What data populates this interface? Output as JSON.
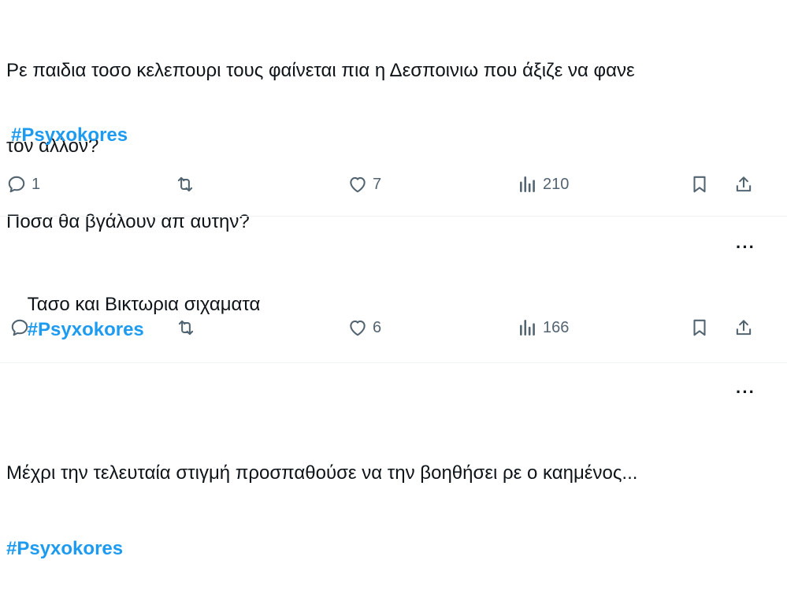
{
  "tweets": [
    {
      "lines": [
        "Ρε παιδια τοσο κελεπουρι τους φαίνεται πια η Δεσποινιω που άξιζε να φανε",
        "τον αλλον?",
        "Ποσα θα βγάλουν απ αυτην?"
      ],
      "hashtag": "#Psyxokores",
      "replies": "1",
      "likes": "7",
      "views": "210"
    },
    {
      "text": "Τασο και Βικτωρια σιχαματα",
      "hashtag": "#Psyxokores",
      "replies": "",
      "likes": "6",
      "views": "166",
      "more": "···"
    },
    {
      "text": "Μέχρι την τελευταία στιγμή προσπαθούσε να την βοηθήσει ρε ο καημένος...",
      "hashtag": "#Psyxokores",
      "more": "···"
    }
  ]
}
